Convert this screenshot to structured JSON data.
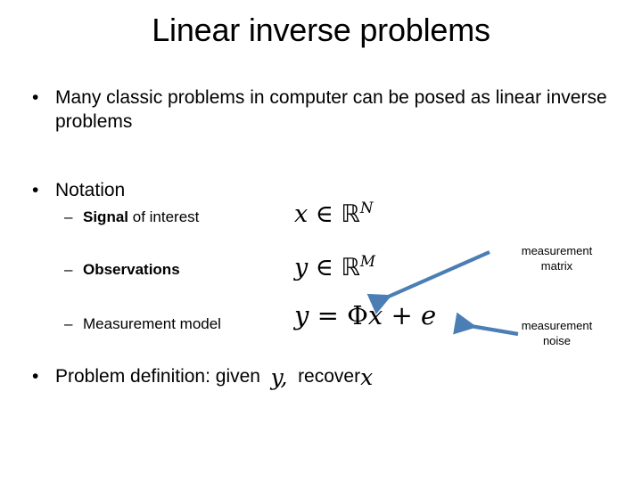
{
  "slide": {
    "title": "Linear inverse problems",
    "bullets": [
      {
        "level": 1,
        "marker": "•",
        "text": "Many classic problems in computer can be posed as linear inverse problems"
      },
      {
        "level": 1,
        "marker": "•",
        "text": "Notation"
      },
      {
        "level": 2,
        "marker": "–",
        "label_bold": "Signal",
        "label_rest": " of interest"
      },
      {
        "level": 2,
        "marker": "–",
        "label_bold": "Observations",
        "label_rest": ""
      },
      {
        "level": 2,
        "marker": "–",
        "label_bold": "",
        "label_rest": "Measurement model"
      }
    ],
    "problem_bullet": {
      "marker": "•",
      "prefix": "Problem definition: given",
      "given_symbol": "y,",
      "middle": "recover",
      "recover_symbol": "x"
    },
    "equations": {
      "signal": {
        "var": "x",
        "op": "∈",
        "set": "ℝ",
        "exponent": "N"
      },
      "observation": {
        "var": "y",
        "op": "∈",
        "set": "ℝ",
        "exponent": "M"
      },
      "model": {
        "lhs": "y",
        "eq": "=",
        "matrix": "Φ",
        "signal": "x",
        "plus": "+",
        "noise": "e"
      }
    },
    "callouts": [
      {
        "id": "matrix",
        "line1": "measurement",
        "line2": "matrix"
      },
      {
        "id": "noise",
        "line1": "measurement",
        "line2": "noise"
      }
    ],
    "colors": {
      "background": "#ffffff",
      "text": "#000000",
      "arrow": "#4A7EB5"
    }
  }
}
